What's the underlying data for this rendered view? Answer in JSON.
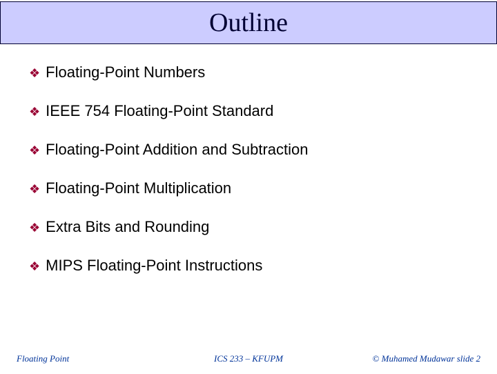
{
  "title": "Outline",
  "items": [
    "Floating-Point Numbers",
    "IEEE 754 Floating-Point Standard",
    "Floating-Point Addition and Subtraction",
    "Floating-Point Multiplication",
    "Extra Bits and Rounding",
    "MIPS Floating-Point Instructions"
  ],
  "footer": {
    "left": "Floating Point",
    "center": "ICS 233 – KFUPM",
    "right": "© Muhamed Mudawar slide 2"
  },
  "bullet_glyph": "❖"
}
